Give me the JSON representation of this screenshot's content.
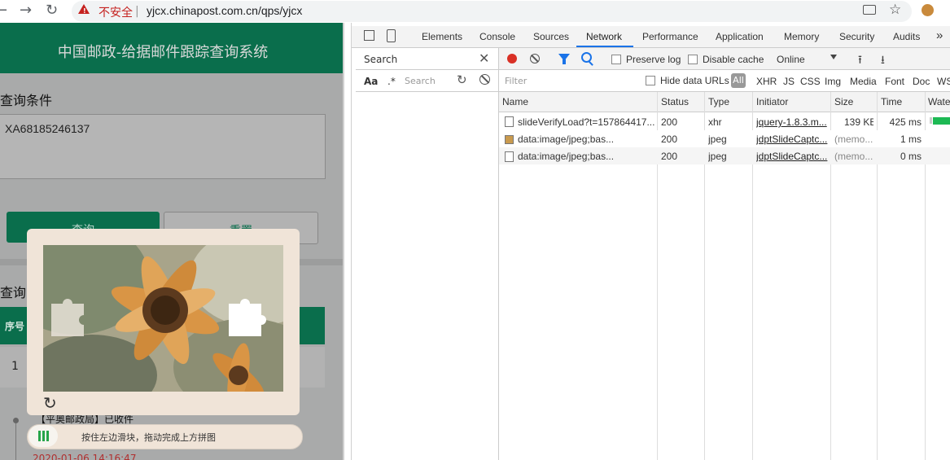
{
  "browser": {
    "security_label": "不安全",
    "separator": "|",
    "url": "yjcx.chinapost.com.cn/qps/yjcx"
  },
  "page": {
    "title": "中国邮政-给据邮件跟踪查询系统",
    "condition_label": "查询条件",
    "tracking_number": "XA68185246137",
    "query_button": "查询",
    "reset_button": "重置",
    "result_label": "查询",
    "table_header_no": "序号",
    "row_no": "1",
    "event_text": "【平奥邮政局】已收件",
    "event_date": "2020-01-06 14:16:47"
  },
  "captcha": {
    "slider_hint": "按住左边滑块，拖动完成上方拼图"
  },
  "devtools": {
    "tabs": [
      "Elements",
      "Console",
      "Sources",
      "Network",
      "Performance",
      "Application",
      "Memory",
      "Security",
      "Audits",
      "»"
    ],
    "active_tab": "Network",
    "search_title": "Search",
    "search_case": "Aa",
    "search_regex": ".*",
    "search_placeholder": "Search",
    "preserve_log": "Preserve log",
    "disable_cache": "Disable cache",
    "throttle": "Online",
    "filter_placeholder": "Filter",
    "hide_data_urls": "Hide data URLs",
    "filter_types": [
      "All",
      "XHR",
      "JS",
      "CSS",
      "Img",
      "Media",
      "Font",
      "Doc",
      "WS"
    ],
    "columns": [
      "Name",
      "Status",
      "Type",
      "Initiator",
      "Size",
      "Time",
      "Wate"
    ],
    "requests": [
      {
        "name": "slideVerifyLoad?t=157864417...",
        "status": "200",
        "type": "xhr",
        "initiator": "jquery-1.8.3.m...",
        "size": "139 KB",
        "time": "425 ms"
      },
      {
        "name": "data:image/jpeg;bas...",
        "status": "200",
        "type": "jpeg",
        "initiator": "jdptSlideCaptc...",
        "size": "(memo...",
        "time": "1 ms"
      },
      {
        "name": "data:image/jpeg;bas...",
        "status": "200",
        "type": "jpeg",
        "initiator": "jdptSlideCaptc...",
        "size": "(memo...",
        "time": "0 ms"
      }
    ]
  }
}
